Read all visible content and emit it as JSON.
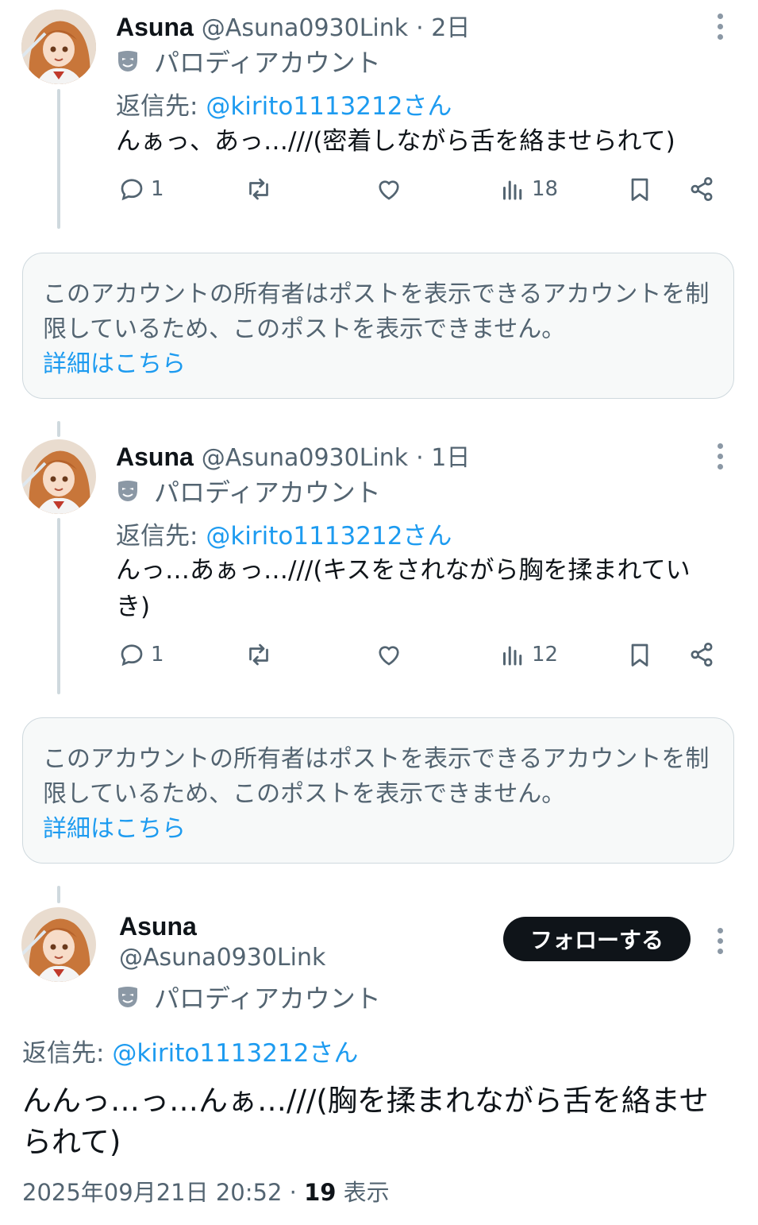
{
  "colors": {
    "accent": "#1d9bf0",
    "text": "#0f1419",
    "muted": "#536471",
    "line": "#cfd9de"
  },
  "posts": [
    {
      "name": "Asuna",
      "handle": "@Asuna0930Link",
      "time": "· 2日",
      "parody_label": "パロディアカウント",
      "reply_prefix": "返信先:",
      "reply_mention": "@kirito1113212さん",
      "text": "んぁっ、あっ…///(密着しながら舌を絡ませられて)",
      "replies": "1",
      "views": "18"
    },
    {
      "name": "Asuna",
      "handle": "@Asuna0930Link",
      "time": "· 1日",
      "parody_label": "パロディアカウント",
      "reply_prefix": "返信先:",
      "reply_mention": "@kirito1113212さん",
      "text": "んっ…あぁっ…///(キスをされながら胸を揉まれていき)",
      "replies": "1",
      "views": "12"
    }
  ],
  "notices": [
    {
      "text": "このアカウントの所有者はポストを表示できるアカウントを制限しているため、このポストを表示できません。",
      "link": "詳細はこちら"
    },
    {
      "text": "このアカウントの所有者はポストを表示できるアカウントを制限しているため、このポストを表示できません。",
      "link": "詳細はこちら"
    }
  ],
  "main_post": {
    "name": "Asuna",
    "handle": "@Asuna0930Link",
    "follow_label": "フォローする",
    "parody_label": "パロディアカウント",
    "reply_prefix": "返信先:",
    "reply_mention": "@kirito1113212さん",
    "text": "んんっ…っ…んぁ…///(胸を揉まれながら舌を絡ませられて)",
    "timestamp": "2025年09月21日 20:52 ·",
    "views_count": "19",
    "views_label": "表示"
  }
}
